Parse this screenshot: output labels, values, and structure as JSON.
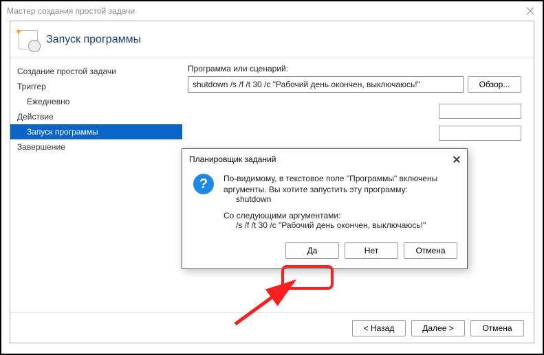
{
  "window": {
    "title": "Мастер создания простой задачи"
  },
  "banner": {
    "title": "Запуск программы"
  },
  "sidebar": {
    "items": [
      {
        "label": "Создание простой задачи"
      },
      {
        "label": "Триггер"
      },
      {
        "label": "Ежедневно"
      },
      {
        "label": "Действие"
      },
      {
        "label": "Запуск программы"
      },
      {
        "label": "Завершение"
      }
    ]
  },
  "main": {
    "program_label": "Программа или сценарий:",
    "program_value": "shutdown /s /f /t 30 /c \"Рабочий день окончен, выключаюсь!\"",
    "browse_label": "Обзор..."
  },
  "footer": {
    "back": "< Назад",
    "next": "Далее >",
    "cancel": "Отмена"
  },
  "modal": {
    "title": "Планировщик заданий",
    "msg1": "По-видимому, в текстовое поле \"Программы\" включены",
    "msg2": "аргументы. Вы хотите запустить эту программу:",
    "program": "shutdown",
    "msg3": "Со следующими аргументами:",
    "args": "/s /f /t 30 /c \"Рабочий день окончен, выключаюсь!\"",
    "yes": "Да",
    "no": "Нет",
    "cancel": "Отмена"
  }
}
